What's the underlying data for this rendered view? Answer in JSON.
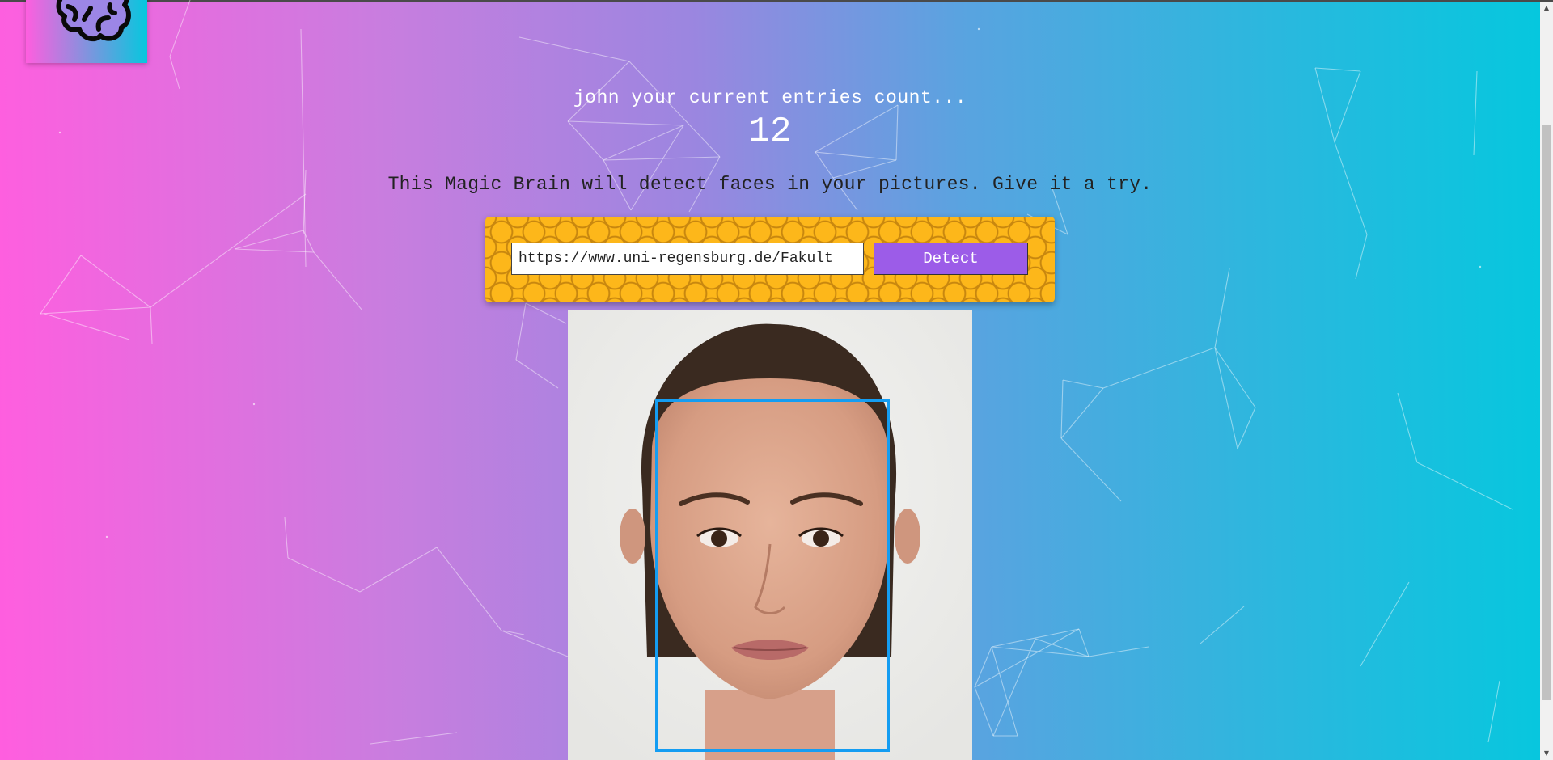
{
  "header": {
    "logo_icon": "brain-icon"
  },
  "rank": {
    "title": "john your current entries count...",
    "count": "12"
  },
  "description": "This Magic Brain will detect faces in your pictures. Give it a try.",
  "form": {
    "input_value": "https://www.uni-regensburg.de/Fakult",
    "button_label": "Detect"
  },
  "result": {
    "image_icon": "face-photo",
    "face_count": 1
  },
  "colors": {
    "gradient_start": "#ff5edf",
    "gradient_end": "#04c8de",
    "form_panel": "#fdb71a",
    "button": "#9c5ce8",
    "bounding_box": "#149df2"
  }
}
